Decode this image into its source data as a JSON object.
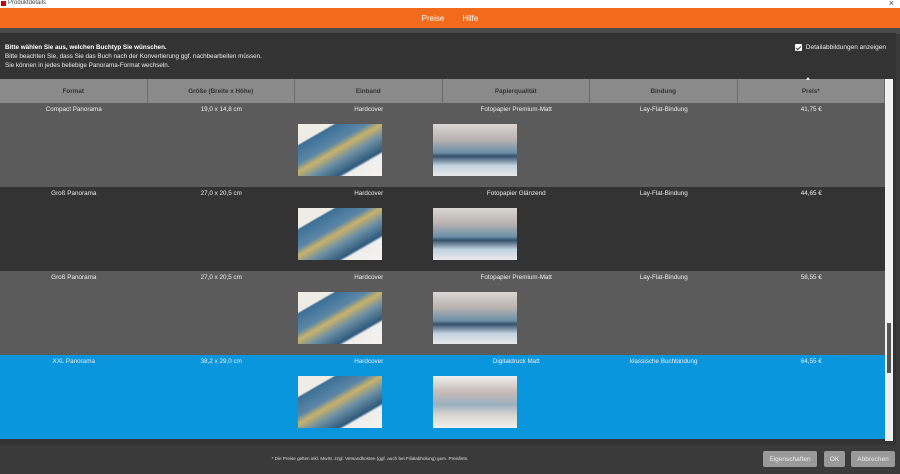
{
  "window": {
    "title": "Produktdetails",
    "close": "×"
  },
  "menu": [
    "Preise",
    "Hilfe"
  ],
  "intro": {
    "bold": "Bitte wählen Sie aus, welchen Buchtyp Sie wünschen.",
    "line1": "Bitte beachten Sie, dass Sie das Buch nach der Konvertierung ggf. nachbearbeiten müssen.",
    "line2": "Sie können in jedes beliebige Panorama-Format wechseln."
  },
  "detail_checkbox": {
    "label": "Detailabbildungen anzeigen",
    "checked": true
  },
  "columns": [
    "Format",
    "Größe (Breite x Höhe)",
    "Einband",
    "Papierqualität",
    "Bindung",
    "Preis*"
  ],
  "rows": [
    {
      "format": "Compact Panorama",
      "size": "19,0 x 14,8 cm",
      "cover": "Hardcover",
      "paper": "Fotopapier Premium-Matt",
      "binding": "Lay-Flat-Bindung",
      "price": "41,75 €",
      "bg": "#5b5b5b"
    },
    {
      "format": "Groß Panorama",
      "size": "27,0 x 20,5 cm",
      "cover": "Hardcover",
      "paper": "Fotopapier Glänzend",
      "binding": "Lay-Flat-Bindung",
      "price": "44,65 €",
      "bg": "#333333"
    },
    {
      "format": "Groß Panorama",
      "size": "27,0 x 20,5 cm",
      "cover": "Hardcover",
      "paper": "Fotopapier Premium-Matt",
      "binding": "Lay-Flat-Bindung",
      "price": "58,55 €",
      "bg": "#5b5b5b"
    },
    {
      "format": "XXL Panorama",
      "size": "38,2 x 29,0 cm",
      "cover": "Hardcover",
      "paper": "Digitaldruck Matt",
      "binding": "klassische Buchbindung",
      "price": "64,55 €",
      "bg": "#0a96dc"
    }
  ],
  "footnote": "* Die Preise gelten inkl. MwSt. zzgl. Versandkosten (ggf. auch bei Filialabholung) gem. Preisliste.",
  "buttons": {
    "properties": "Eigenschaften",
    "ok": "OK",
    "cancel": "Abbrechen"
  }
}
